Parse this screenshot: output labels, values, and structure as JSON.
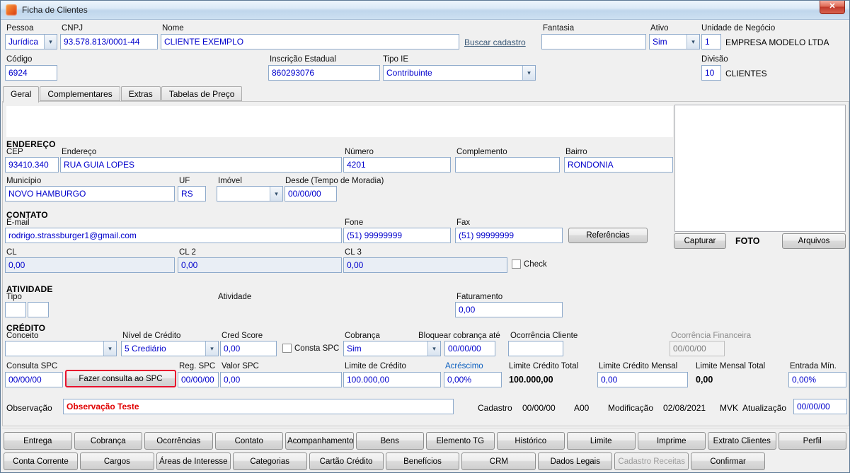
{
  "window": {
    "title": "Ficha de Clientes"
  },
  "icons": {
    "close": "✕",
    "dropdown": "▾"
  },
  "colors": {
    "field_text": "#0000CC",
    "alert_red": "#E00000",
    "link": "#3C5A78",
    "spc_highlight": "#E8112D"
  },
  "header": {
    "pessoa": {
      "label": "Pessoa",
      "value": "Jurídica"
    },
    "cnpj": {
      "label": "CNPJ",
      "value": "93.578.813/0001-44"
    },
    "nome": {
      "label": "Nome",
      "value": "CLIENTE EXEMPLO"
    },
    "buscar_cadastro": "Buscar cadastro",
    "fantasia": {
      "label": "Fantasia",
      "value": ""
    },
    "ativo": {
      "label": "Ativo",
      "value": "Sim"
    },
    "unidade": {
      "label": "Unidade de Negócio",
      "code": "1",
      "name": "EMPRESA MODELO LTDA"
    },
    "codigo": {
      "label": "Código",
      "value": "6924"
    },
    "inscricao_estadual": {
      "label": "Inscrição Estadual",
      "value": "860293076"
    },
    "tipo_ie": {
      "label": "Tipo IE",
      "value": "Contribuinte"
    },
    "divisao": {
      "label": "Divisão",
      "code": "10",
      "name": "CLIENTES"
    }
  },
  "tabs": {
    "geral": "Geral",
    "complementares": "Complementares",
    "extras": "Extras",
    "tabelas_preco": "Tabelas de Preço"
  },
  "endereco": {
    "title": "ENDEREÇO",
    "cep": {
      "label": "CEP",
      "value": "93410.340"
    },
    "endereco": {
      "label": "Endereço",
      "value": "RUA GUIA LOPES"
    },
    "numero": {
      "label": "Número",
      "value": "4201"
    },
    "complemento": {
      "label": "Complemento",
      "value": ""
    },
    "bairro": {
      "label": "Bairro",
      "value": "RONDONIA"
    },
    "municipio": {
      "label": "Município",
      "value": "NOVO HAMBURGO"
    },
    "uf": {
      "label": "UF",
      "value": "RS"
    },
    "imovel": {
      "label": "Imóvel",
      "value": ""
    },
    "desde": {
      "label": "Desde (Tempo de Moradia)",
      "value": "00/00/00"
    }
  },
  "contato": {
    "title": "CONTATO",
    "email": {
      "label": "E-mail",
      "value": "rodrigo.strassburger1@gmail.com"
    },
    "fone": {
      "label": "Fone",
      "value": "(51) 99999999"
    },
    "fax": {
      "label": "Fax",
      "value": "(51) 99999999"
    },
    "referencias_label": "Referências",
    "cl": {
      "label": "CL",
      "value": "0,00"
    },
    "cl2": {
      "label": "CL 2",
      "value": "0,00"
    },
    "cl3": {
      "label": "CL 3",
      "value": "0,00"
    },
    "check_label": "Check"
  },
  "foto": {
    "capturar_label": "Capturar",
    "titulo": "FOTO",
    "arquivos_label": "Arquivos"
  },
  "atividade": {
    "title": "ATIVIDADE",
    "tipo_label": "Tipo",
    "tipo1": "",
    "tipo2": "",
    "atividade_label": "Atividade",
    "faturamento": {
      "label": "Faturamento",
      "value": "0,00"
    }
  },
  "credito": {
    "title": "CRÉDITO",
    "conceito": {
      "label": "Conceito",
      "value": ""
    },
    "nivel_credito": {
      "label": "Nível de Crédito",
      "value": "5 Crediário"
    },
    "cred_score": {
      "label": "Cred Score",
      "value": "0,00"
    },
    "consta_spc_label": "Consta SPC",
    "cobranca": {
      "label": "Cobrança",
      "value": "Sim"
    },
    "bloquear_ate": {
      "label": "Bloquear cobrança até",
      "value": "00/00/00"
    },
    "ocorrencia_cliente": {
      "label": "Ocorrência Cliente",
      "value": ""
    },
    "ocorrencia_financeira": {
      "label": "Ocorrência Financeira",
      "value": "00/00/00"
    },
    "consulta_spc": {
      "label": "Consulta SPC",
      "value": "00/00/00"
    },
    "fazer_consulta_label": "Fazer consulta ao SPC",
    "reg_spc": {
      "label": "Reg. SPC",
      "value": "00/00/00"
    },
    "valor_spc": {
      "label": "Valor SPC",
      "value": "0,00"
    },
    "limite_credito": {
      "label": "Limite de Crédito",
      "value": "100.000,00"
    },
    "acrescimo": {
      "label": "Acréscimo",
      "value": "0,00%"
    },
    "limite_credito_total": {
      "label": "Limite Crédito Total",
      "value": "100.000,00"
    },
    "limite_credito_mensal": {
      "label": "Limite Crédito Mensal",
      "value": "0,00"
    },
    "limite_mensal_total": {
      "label": "Limite Mensal Total",
      "value": "0,00"
    },
    "entrada_min": {
      "label": "Entrada Mín.",
      "value": "0,00%"
    }
  },
  "observacao": {
    "label": "Observação",
    "value": "Observação Teste",
    "cadastro_label": "Cadastro",
    "cadastro_value": "00/00/00",
    "cadastro_user": "A00",
    "modificacao_label": "Modificação",
    "modificacao_value": "02/08/2021",
    "modificacao_user": "MVK",
    "atualizacao_label": "Atualização",
    "atualizacao_value": "00/00/00"
  },
  "buttons_row1": [
    "Entrega",
    "Cobrança",
    "Ocorrências",
    "Contato",
    "Acompanhamento",
    "Bens",
    "Elemento TG",
    "Histórico",
    "Limite",
    "Imprime",
    "Extrato Clientes",
    "Perfil"
  ],
  "buttons_row2": [
    "Conta Corrente",
    "Cargos",
    "Áreas de Interesse",
    "Categorias",
    "Cartão Crédito",
    "Benefícios",
    "CRM",
    "Dados Legais",
    "Cadastro Receitas",
    "Confirmar"
  ]
}
